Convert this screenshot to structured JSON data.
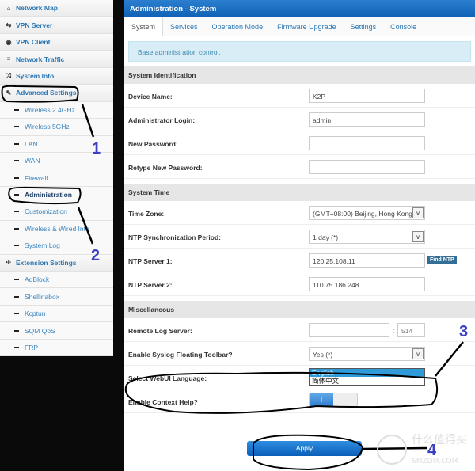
{
  "sidebar": {
    "items": [
      {
        "label": "Network Map",
        "icon": "home-icon",
        "type": "top"
      },
      {
        "label": "VPN Server",
        "icon": "swap-icon",
        "type": "top"
      },
      {
        "label": "VPN Client",
        "icon": "globe-icon",
        "type": "top"
      },
      {
        "label": "Network Traffic",
        "icon": "list-icon",
        "type": "top"
      },
      {
        "label": "System Info",
        "icon": "shuffle-icon",
        "type": "top"
      },
      {
        "label": "Advanced Settings",
        "icon": "wrench-icon",
        "type": "top"
      },
      {
        "label": "Wireless 2.4GHz",
        "type": "sub"
      },
      {
        "label": "Wireless 5GHz",
        "type": "sub"
      },
      {
        "label": "LAN",
        "type": "sub"
      },
      {
        "label": "WAN",
        "type": "sub"
      },
      {
        "label": "Firewall",
        "type": "sub"
      },
      {
        "label": "Administration",
        "type": "sub",
        "active": true
      },
      {
        "label": "Customization",
        "type": "sub"
      },
      {
        "label": "Wireless & Wired Info",
        "type": "sub"
      },
      {
        "label": "System Log",
        "type": "sub"
      },
      {
        "label": "Extension Settings",
        "icon": "plane-icon",
        "type": "top"
      },
      {
        "label": "AdBlock",
        "type": "sub"
      },
      {
        "label": "Shellinabox",
        "type": "sub"
      },
      {
        "label": "Kcptun",
        "type": "sub"
      },
      {
        "label": "SQM QoS",
        "type": "sub"
      },
      {
        "label": "FRP",
        "type": "sub"
      }
    ]
  },
  "header": {
    "title": "Administration - System"
  },
  "tabs": [
    "System",
    "Services",
    "Operation Mode",
    "Firmware Upgrade",
    "Settings",
    "Console"
  ],
  "info": "Base administration control.",
  "sections": {
    "ident": {
      "title": "System Identification",
      "device_name": "Device Name:",
      "device_value": "K2P",
      "admin_login": "Administrator Login:",
      "admin_value": "admin",
      "new_pw": "New Password:",
      "retype_pw": "Retype New Password:"
    },
    "time": {
      "title": "System Time",
      "tz": "Time Zone:",
      "tz_value": "(GMT+08:00) Beijing, Hong Kong",
      "ntp_period": "NTP Synchronization Period:",
      "ntp_period_value": "1 day (*)",
      "ntp1": "NTP Server 1:",
      "ntp1_value": "120.25.108.11",
      "find_ntp": "Find NTP",
      "ntp2": "NTP Server 2:",
      "ntp2_value": "110.75.186.248"
    },
    "misc": {
      "title": "Miscellaneous",
      "remote_log": "Remote Log Server:",
      "remote_port": "514",
      "port_sep": ":",
      "syslog_toolbar": "Enable Syslog Floating Toolbar?",
      "syslog_value": "Yes (*)",
      "lang": "Select WebUI Language:",
      "lang_options": [
        "English",
        "简体中文"
      ],
      "context_help": "Enable Context Help?",
      "toggle_on": "I"
    }
  },
  "apply": "Apply",
  "annotations": [
    "1",
    "2",
    "3",
    "4"
  ],
  "watermark": "什么值得买 SMZDM.COM"
}
